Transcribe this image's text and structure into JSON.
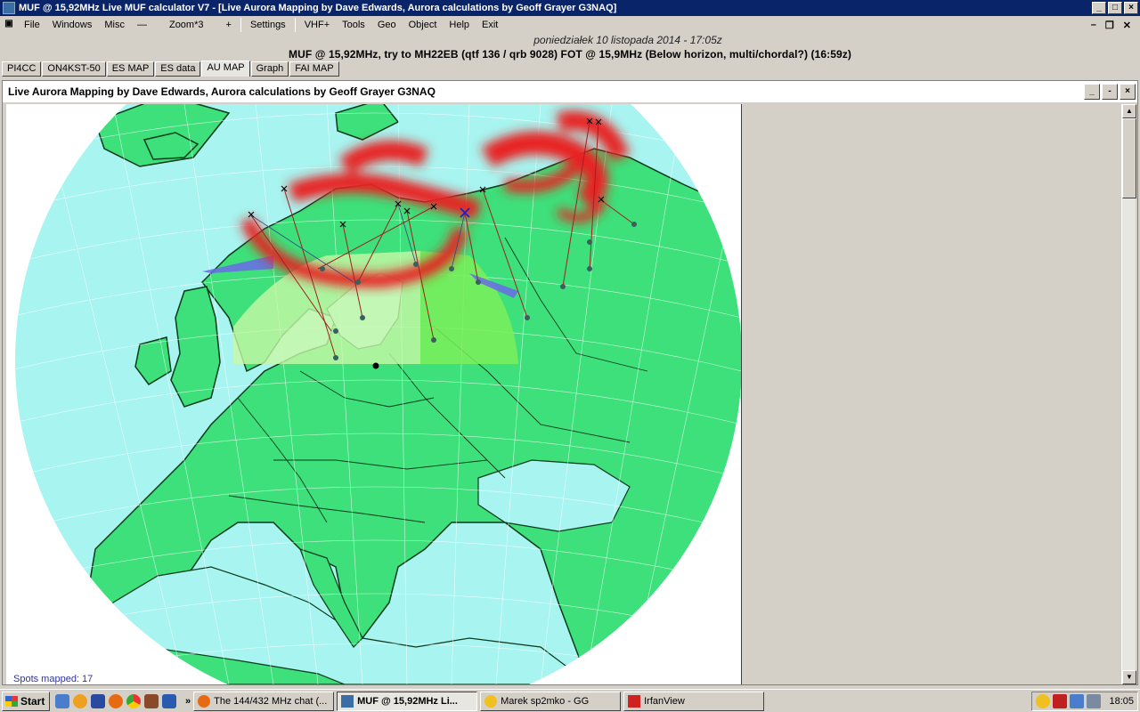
{
  "window": {
    "title": "MUF @ 15,92MHz    Live MUF calculator V7 - [Live Aurora Mapping by Dave Edwards, Aurora calculations by Geoff Grayer G3NAQ]"
  },
  "menu": {
    "items": [
      "File",
      "Windows",
      "Misc",
      "—",
      "Zoom*3",
      "+",
      "Settings",
      "VHF+",
      "Tools",
      "Geo",
      "Object",
      "Help",
      "Exit"
    ]
  },
  "info": {
    "date": "poniedziałek 10 listopada 2014 - 17:05z",
    "muf_line": "MUF @ 15,92MHz, try to MH22EB (qtf 136 / qrb 9028)      FOT @ 15,9MHz (Below horizon, multi/chordal?) (16:59z)"
  },
  "tabs": [
    "PI4CC",
    "ON4KST-50",
    "ES MAP",
    "ES data",
    "AU MAP",
    "Graph",
    "FAI MAP"
  ],
  "active_tab": "AU MAP",
  "child": {
    "title": "Live Aurora Mapping by Dave Edwards, Aurora calculations by Geoff Grayer G3NAQ"
  },
  "map": {
    "spots_label": "Spots mapped: 17"
  },
  "taskbar": {
    "start": "Start",
    "buttons": [
      "The 144/432 MHz chat (...",
      "MUF @ 15,92MHz     Li...",
      "Marek sp2mko - GG",
      "IrfanView"
    ],
    "clock": "18:05"
  },
  "colors": {
    "land": "#3de07a",
    "sea": "#a8f4f0",
    "aurora": "#e82020",
    "titlebar": "#0a246a"
  }
}
